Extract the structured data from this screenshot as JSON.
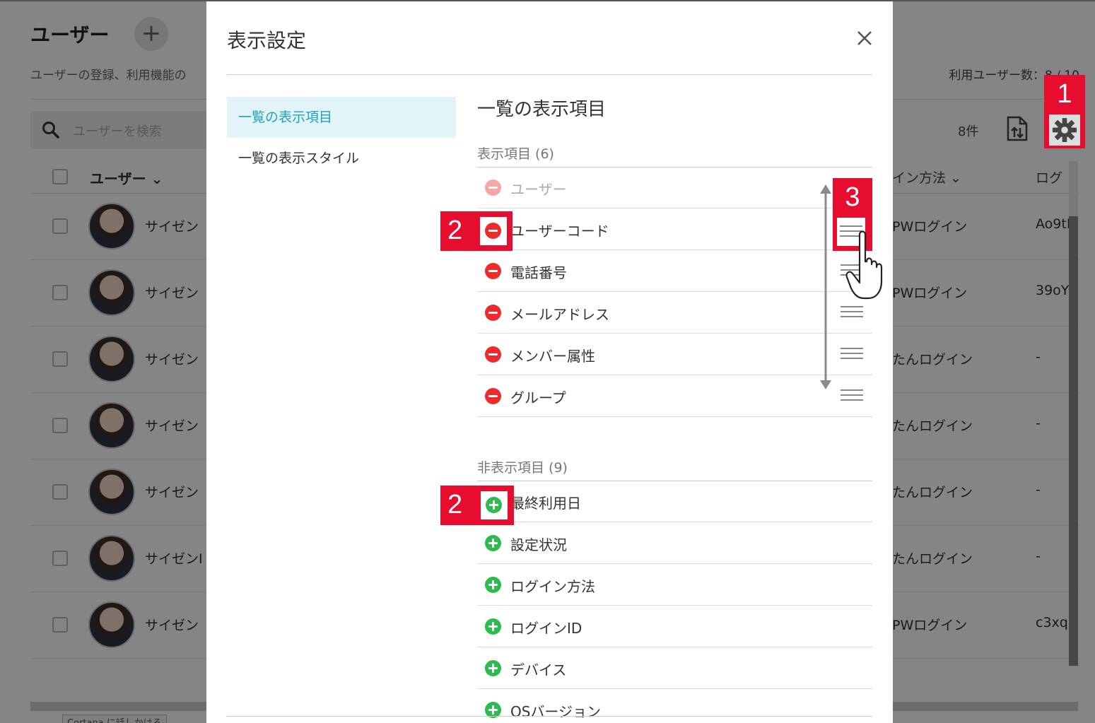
{
  "background": {
    "title": "ユーザー",
    "subtitle": "ユーザーの登録、利用機能の",
    "user_count": "利用ユーザー数：8 / 10",
    "search_placeholder": "ユーザーを検索",
    "result_count": "8件",
    "columns": {
      "user": "ユーザー",
      "login_method": "イン方法",
      "login_id": "ログ"
    },
    "rows": [
      {
        "name": "サイゼン",
        "login": "PWログイン",
        "id": "Ao9tI"
      },
      {
        "name": "サイゼン",
        "login": "PWログイン",
        "id": "39oY"
      },
      {
        "name": "サイゼン",
        "login": "たんログイン",
        "id": "-"
      },
      {
        "name": "サイゼン",
        "login": "たんログイン",
        "id": "-"
      },
      {
        "name": "サイゼン",
        "login": "たんログイン",
        "id": "-"
      },
      {
        "name": "サイゼンI",
        "login": "たんログイン",
        "id": "-"
      },
      {
        "name": "サイゼン",
        "login": "PWログイン",
        "id": "c3xq"
      }
    ],
    "taskbar_hint": "Cortana に話しかける"
  },
  "modal": {
    "title": "表示設定",
    "nav": [
      {
        "label": "一覧の表示項目",
        "active": true
      },
      {
        "label": "一覧の表示スタイル",
        "active": false
      }
    ],
    "section_title": "一覧の表示項目",
    "visible_group_label": "表示項目 (6)",
    "visible_items": [
      {
        "label": "ユーザー",
        "locked": true
      },
      {
        "label": "ユーザーコード",
        "locked": false
      },
      {
        "label": "電話番号",
        "locked": false
      },
      {
        "label": "メールアドレス",
        "locked": false
      },
      {
        "label": "メンバー属性",
        "locked": false
      },
      {
        "label": "グループ",
        "locked": false
      }
    ],
    "hidden_group_label": "非表示項目 (9)",
    "hidden_items": [
      {
        "label": "最終利用日"
      },
      {
        "label": "設定状況"
      },
      {
        "label": "ログイン方法"
      },
      {
        "label": "ログインID"
      },
      {
        "label": "デバイス"
      },
      {
        "label": "OSバージョン"
      }
    ]
  },
  "callouts": {
    "step1": "1",
    "step2a": "2",
    "step2b": "2",
    "step3": "3"
  },
  "colors": {
    "accent": "#1ea0c3",
    "callout": "#e60d2e",
    "remove": "#ee2a2a",
    "add": "#2cbb4c"
  }
}
